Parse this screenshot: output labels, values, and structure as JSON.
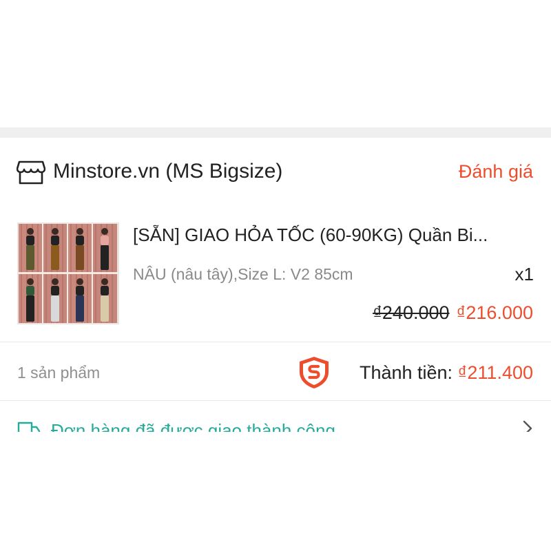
{
  "shop": {
    "icon": "shop-icon",
    "name": "Minstore.vn (MS Bigsize)",
    "rate_label": "Đánh giá"
  },
  "product": {
    "title": "[SẴN] GIAO HỎA TỐC (60-90KG) Quần Bi...",
    "variant": "NÂU (nâu tây),Size L: V2 85cm",
    "quantity": "x1",
    "price_original": "₫240.000",
    "price_sale": "₫216.000"
  },
  "summary": {
    "count_label": "1 sản phẩm",
    "voucher_icon": "shopee-guarantee-shield-icon",
    "total_label": "Thành tiền: ",
    "total_value": "₫211.400"
  },
  "status": {
    "icon": "truck-icon",
    "text": "Đơn hàng đã được giao thành công",
    "chevron": "chevron-right-icon"
  },
  "colors": {
    "accent": "#ee4d2d",
    "status_green": "#26aa99",
    "muted_text": "#8a8a8a",
    "separator": "#efefef"
  }
}
